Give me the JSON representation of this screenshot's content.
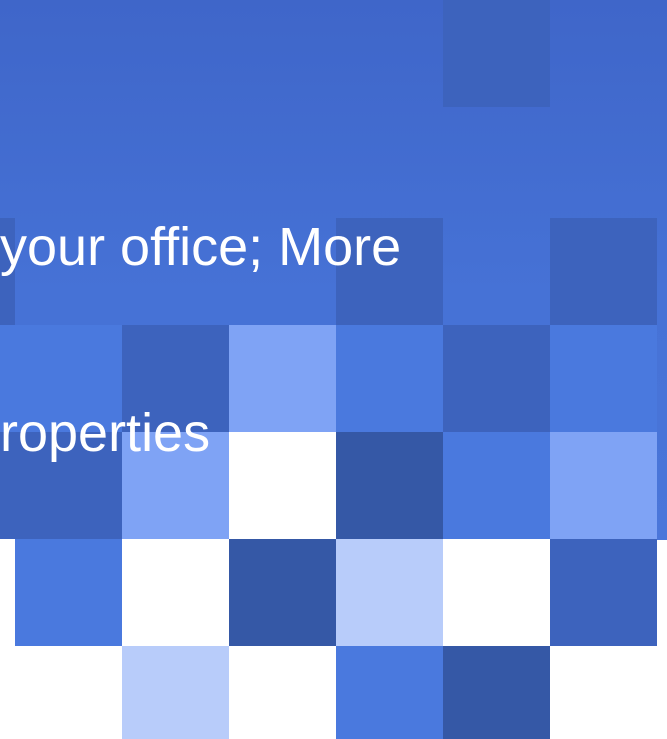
{
  "headline": {
    "line1": "your office; More",
    "line2": "roperties"
  },
  "colors": {
    "bg_top": "#3f66c9",
    "bg_bottom": "#4a76da",
    "text": "#ffffff",
    "tile_white": "#ffffff",
    "tile_pale": "#b8ccfa",
    "tile_light": "#7fa3f5",
    "tile_mid": "#4a79de",
    "tile_dark": "#3d63bd",
    "tile_navy": "#3558a6"
  }
}
